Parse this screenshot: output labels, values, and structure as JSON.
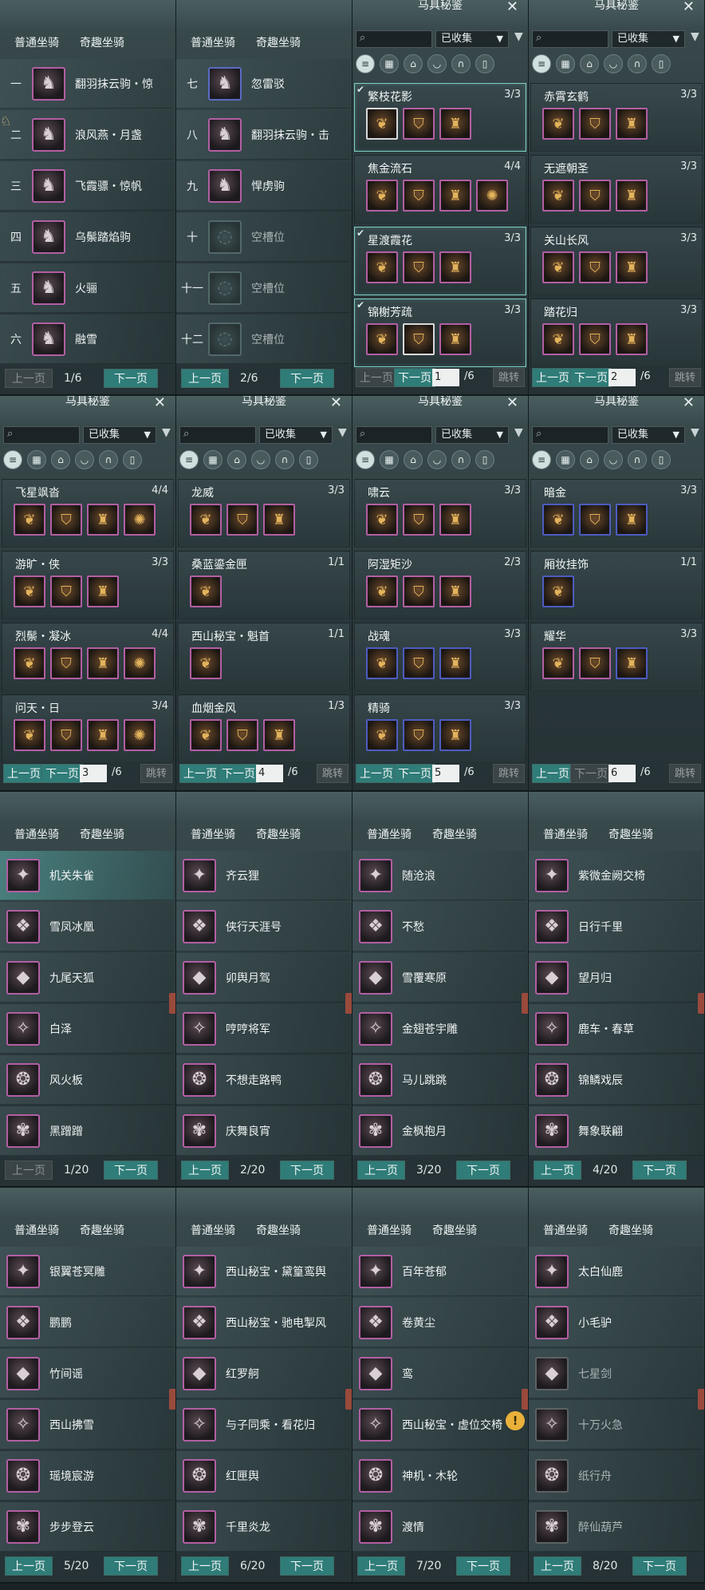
{
  "mountTabs": [
    "普通坐骑",
    "奇趣坐骑"
  ],
  "nav": {
    "prev": "上一页",
    "next": "下一页",
    "jump": "跳转"
  },
  "book": {
    "title": "马具秘鉴",
    "filter": "已收集"
  },
  "mountPanels": [
    {
      "page": "1/6",
      "prev_enabled": false,
      "items": [
        {
          "slot": "一",
          "name": "翻羽抹云驹・惊",
          "glyph": "🐴"
        },
        {
          "slot": "二",
          "name": "浪风燕・月盏",
          "glyph": "🐴"
        },
        {
          "slot": "三",
          "name": "飞霞骠・惊帆",
          "glyph": "🐴"
        },
        {
          "slot": "四",
          "name": "乌鬃踏焰驹",
          "glyph": "🐴"
        },
        {
          "slot": "五",
          "name": "火骊",
          "glyph": "🐴"
        },
        {
          "slot": "六",
          "name": "融雪",
          "glyph": "🐴"
        }
      ]
    },
    {
      "page": "2/6",
      "prev_enabled": true,
      "items": [
        {
          "slot": "七",
          "name": "忽雷驳",
          "glyph": "🐴",
          "frame": "blue"
        },
        {
          "slot": "八",
          "name": "翻羽抹云驹・击",
          "glyph": "🐴"
        },
        {
          "slot": "九",
          "name": "悍虏驹",
          "glyph": "🐴"
        },
        {
          "slot": "十",
          "name": "空槽位",
          "empty": true
        },
        {
          "slot": "十一",
          "name": "空槽位",
          "empty": true
        },
        {
          "slot": "十二",
          "name": "空槽位",
          "empty": true
        }
      ]
    }
  ],
  "bookPanels": [
    {
      "page": "1",
      "total": "/6",
      "prev_enabled": false,
      "sets": [
        {
          "name": "繁枝花影",
          "count": "3/3",
          "done": true,
          "items": 3,
          "frames": [
            "white",
            "pink",
            "pink"
          ]
        },
        {
          "name": "焦金流石",
          "count": "4/4",
          "items": 4
        },
        {
          "name": "星渡霞花",
          "count": "3/3",
          "done": true,
          "items": 3
        },
        {
          "name": "锦榭芳疏",
          "count": "3/3",
          "done": true,
          "items": 3,
          "frames": [
            "pink",
            "white",
            "pink"
          ]
        }
      ]
    },
    {
      "page": "2",
      "total": "/6",
      "prev_enabled": true,
      "sets": [
        {
          "name": "赤霄玄鹤",
          "count": "3/3",
          "items": 3
        },
        {
          "name": "无遮朝圣",
          "count": "3/3",
          "items": 3
        },
        {
          "name": "关山长风",
          "count": "3/3",
          "items": 3
        },
        {
          "name": "踏花归",
          "count": "3/3",
          "items": 3
        }
      ]
    },
    {
      "page": "3",
      "total": "/6",
      "prev_enabled": true,
      "sets": [
        {
          "name": "飞星飒沓",
          "count": "4/4",
          "items": 4
        },
        {
          "name": "游旷・侠",
          "count": "3/3",
          "items": 3
        },
        {
          "name": "烈鬃・凝冰",
          "count": "4/4",
          "items": 4
        },
        {
          "name": "问天・日",
          "count": "3/4",
          "items": 4
        }
      ]
    },
    {
      "page": "4",
      "total": "/6",
      "prev_enabled": true,
      "sets": [
        {
          "name": "龙威",
          "count": "3/3",
          "items": 3
        },
        {
          "name": "桑蓝鎏金匣",
          "count": "1/1",
          "items": 1
        },
        {
          "name": "西山秘宝・魁首",
          "count": "1/1",
          "items": 1
        },
        {
          "name": "血烟金风",
          "count": "1/3",
          "items": 3
        }
      ]
    },
    {
      "page": "5",
      "total": "/6",
      "prev_enabled": true,
      "sets": [
        {
          "name": "啸云",
          "count": "3/3",
          "items": 3
        },
        {
          "name": "阿湿矩沙",
          "count": "2/3",
          "items": 3
        },
        {
          "name": "战魂",
          "count": "3/3",
          "items": 3,
          "frames": [
            "blue",
            "blue",
            "blue"
          ]
        },
        {
          "name": "精骑",
          "count": "3/3",
          "items": 3,
          "frames": [
            "blue",
            "blue",
            "blue"
          ]
        }
      ]
    },
    {
      "page": "6",
      "total": "/6",
      "prev_enabled": true,
      "next_enabled": false,
      "sets": [
        {
          "name": "暗金",
          "count": "3/3",
          "items": 3,
          "frames": [
            "blue",
            "blue",
            "blue"
          ]
        },
        {
          "name": "厢妆挂饰",
          "count": "1/1",
          "items": 1,
          "frames": [
            "blue"
          ]
        },
        {
          "name": "耀华",
          "count": "3/3",
          "items": 3,
          "frames": [
            "pink",
            "pink",
            "blue"
          ]
        }
      ]
    }
  ],
  "funPanels": [
    {
      "page": "1/20",
      "prev_enabled": false,
      "items": [
        "机关朱雀",
        "雪凤冰凰",
        "九尾天狐",
        "白泽",
        "风火板",
        "黑蹭蹭"
      ]
    },
    {
      "page": "2/20",
      "prev_enabled": true,
      "items": [
        "齐云狸",
        "侠行天涯号",
        "卯舆月驾",
        "哼哼将军",
        "不想走路鸭",
        "庆舞良宵"
      ]
    },
    {
      "page": "3/20",
      "prev_enabled": true,
      "items": [
        "随沧浪",
        "不愁",
        "雪覆寒原",
        "金翅苍宇雕",
        "马儿跳跳",
        "金枫抱月"
      ]
    },
    {
      "page": "4/20",
      "prev_enabled": true,
      "items": [
        "紫微金阙交椅",
        "日行千里",
        "望月归",
        "鹿车・春草",
        "锦鳞戏辰",
        "舞象联翩"
      ]
    },
    {
      "page": "5/20",
      "prev_enabled": true,
      "items": [
        "银翼苍冥雕",
        "鹏鹏",
        "竹间谣",
        "西山拂雪",
        "瑶境宸游",
        "步步登云"
      ]
    },
    {
      "page": "6/20",
      "prev_enabled": true,
      "items": [
        "西山秘宝・黛篁鸾舆",
        "西山秘宝・驰电掣风",
        "红罗舸",
        "与子同乘・看花归",
        "红匣舆",
        "千里炎龙"
      ]
    },
    {
      "page": "7/20",
      "prev_enabled": true,
      "items": [
        "百年苍郁",
        "卷黄尘",
        "鸾",
        "西山秘宝・虚位交椅",
        "神机・木轮",
        "渡情"
      ]
    },
    {
      "page": "8/20",
      "prev_enabled": true,
      "items": [
        "太白仙鹿",
        "小毛驴",
        "七星剑",
        "十万火急",
        "纸行舟",
        "醉仙葫芦"
      ],
      "dim": [
        2,
        3,
        4,
        5
      ]
    }
  ]
}
